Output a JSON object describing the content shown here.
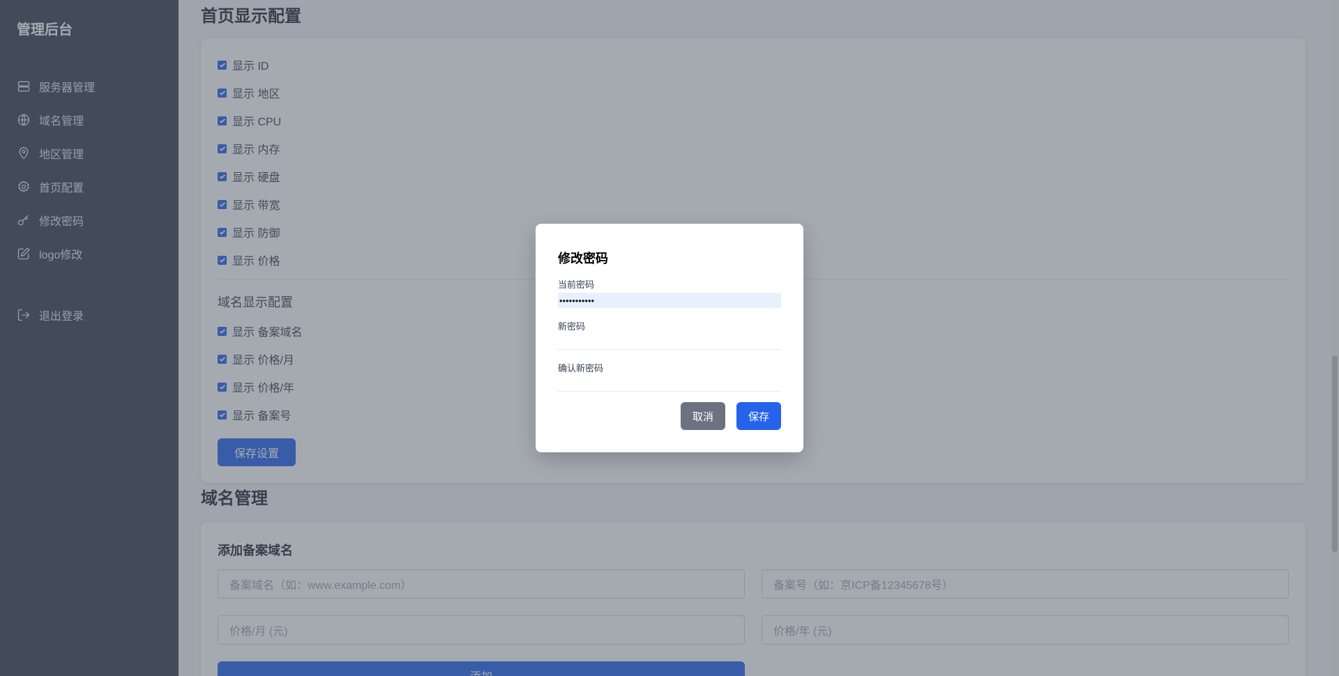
{
  "sidebar": {
    "brand": "管理后台",
    "items": [
      {
        "label": "服务器管理",
        "icon": "server-icon"
      },
      {
        "label": "域名管理",
        "icon": "globe-icon"
      },
      {
        "label": "地区管理",
        "icon": "map-pin-icon"
      },
      {
        "label": "首页配置",
        "icon": "gear-icon"
      },
      {
        "label": "修改密码",
        "icon": "key-icon"
      },
      {
        "label": "logo修改",
        "icon": "edit-icon"
      }
    ],
    "logout": {
      "label": "退出登录",
      "icon": "logout-icon"
    }
  },
  "home_config": {
    "title": "首页显示配置",
    "server_options": [
      "显示 ID",
      "显示 地区",
      "显示 CPU",
      "显示 内存",
      "显示 硬盘",
      "显示 带宽",
      "显示 防御",
      "显示 价格"
    ],
    "domain_section_title": "域名显示配置",
    "domain_options": [
      "显示 备案域名",
      "显示 价格/月",
      "显示 价格/年",
      "显示 备案号"
    ],
    "save_label": "保存设置"
  },
  "domain_mgmt": {
    "title": "域名管理",
    "add_title": "添加备案域名",
    "domain_placeholder": "备案域名（如：www.example.com）",
    "icp_placeholder": "备案号（如：京ICP备12345678号）",
    "price_month_placeholder": "价格/月 (元)",
    "price_year_placeholder": "价格/年 (元)",
    "add_label": "添加"
  },
  "modal": {
    "title": "修改密码",
    "current_label": "当前密码",
    "current_value": "•••••••••••",
    "new_label": "新密码",
    "new_value": "",
    "confirm_label": "确认新密码",
    "confirm_value": "",
    "cancel_label": "取消",
    "save_label": "保存"
  },
  "colors": {
    "sidebar_bg": "#374151",
    "primary": "#2563eb",
    "cancel": "#6b7280",
    "overlay": "rgba(75,85,99,0.5)"
  }
}
